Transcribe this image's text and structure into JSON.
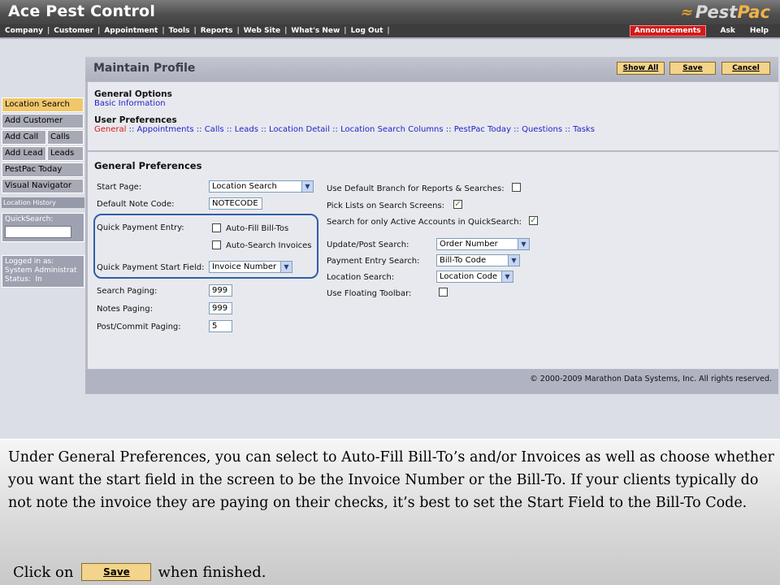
{
  "header": {
    "app_title": "Ace Pest Control",
    "logo_text_a": "Pest",
    "logo_text_b": "Pac"
  },
  "menubar": {
    "left_items": [
      "Company",
      "Customer",
      "Appointment",
      "Tools",
      "Reports",
      "Web Site",
      "What's New",
      "Log Out"
    ],
    "announcements": "Announcements",
    "ask": "Ask",
    "help": "Help"
  },
  "sidebar": {
    "location_search": "Location Search",
    "add_customer": "Add Customer",
    "add_call": "Add Call",
    "calls": "Calls",
    "add_lead": "Add Lead",
    "leads": "Leads",
    "pestpac_today": "PestPac Today",
    "visual_navigator": "Visual Navigator",
    "location_history": "Location History",
    "quicksearch_label": "QuickSearch:",
    "logged_in_label": "Logged in as:",
    "logged_in_user": "System Administrat",
    "status_label": "Status:",
    "status_value": "In"
  },
  "main": {
    "title": "Maintain Profile",
    "show_all_button": "Show All",
    "save_button": "Save",
    "cancel_button": "Cancel",
    "general_options_heading": "General Options",
    "basic_information_link": "Basic Information",
    "user_preferences_heading": "User Preferences",
    "user_pref_links": [
      "General",
      "Appointments",
      "Calls",
      "Leads",
      "Location Detail",
      "Location Search Columns",
      "PestPac Today",
      "Questions",
      "Tasks"
    ],
    "link_separator": " :: "
  },
  "prefs": {
    "title": "General Preferences",
    "start_page_label": "Start Page:",
    "start_page_value": "Location Search",
    "default_note_code_label": "Default Note Code:",
    "default_note_code_value": "NOTECODE",
    "quick_payment_entry_label": "Quick Payment Entry:",
    "auto_fill_bill_tos_label": "Auto-Fill Bill-Tos",
    "auto_fill_bill_tos_checked": false,
    "auto_search_invoices_label": "Auto-Search Invoices",
    "auto_search_invoices_checked": false,
    "quick_payment_start_field_label": "Quick Payment Start Field:",
    "quick_payment_start_field_value": "Invoice Number",
    "search_paging_label": "Search Paging:",
    "search_paging_value": "999",
    "notes_paging_label": "Notes Paging:",
    "notes_paging_value": "999",
    "post_commit_paging_label": "Post/Commit Paging:",
    "post_commit_paging_value": "5",
    "use_default_branch_label": "Use Default Branch for Reports & Searches:",
    "use_default_branch_checked": false,
    "pick_lists_label": "Pick Lists on Search Screens:",
    "pick_lists_checked": true,
    "active_accounts_label": "Search for only Active Accounts in QuickSearch:",
    "active_accounts_checked": true,
    "update_post_search_label": "Update/Post Search:",
    "update_post_search_value": "Order Number",
    "payment_entry_search_label": "Payment Entry Search:",
    "payment_entry_search_value": "Bill-To Code",
    "location_search_label": "Location Search:",
    "location_search_value": "Location Code",
    "use_floating_toolbar_label": "Use Floating Toolbar:",
    "use_floating_toolbar_checked": false,
    "check_mark": "✓",
    "dropdown_arrow": "▼"
  },
  "footer": {
    "copyright": "© 2000-2009 Marathon Data Systems, Inc.  All rights reserved."
  },
  "caption": {
    "text": "Under General Preferences, you can select to Auto-Fill Bill-To’s and/or Invoices as well as choose whether you want the start field in the screen to be the Invoice Number or the Bill-To.  If your clients typically do not note the invoice they are paying on their checks, it’s best to set the Start Field to the Bill-To Code.",
    "click_on": "Click on",
    "save_button_image_label": "Save",
    "when_finished": "when finished."
  },
  "colors": {
    "accent_button": "#f3d48a",
    "active_sidebar": "#f0c76a",
    "link_blue": "#1f24c8",
    "current_link_red": "#d41b1b",
    "highlight_border": "#2f5fa8",
    "announcements_red": "#d01c1c"
  }
}
